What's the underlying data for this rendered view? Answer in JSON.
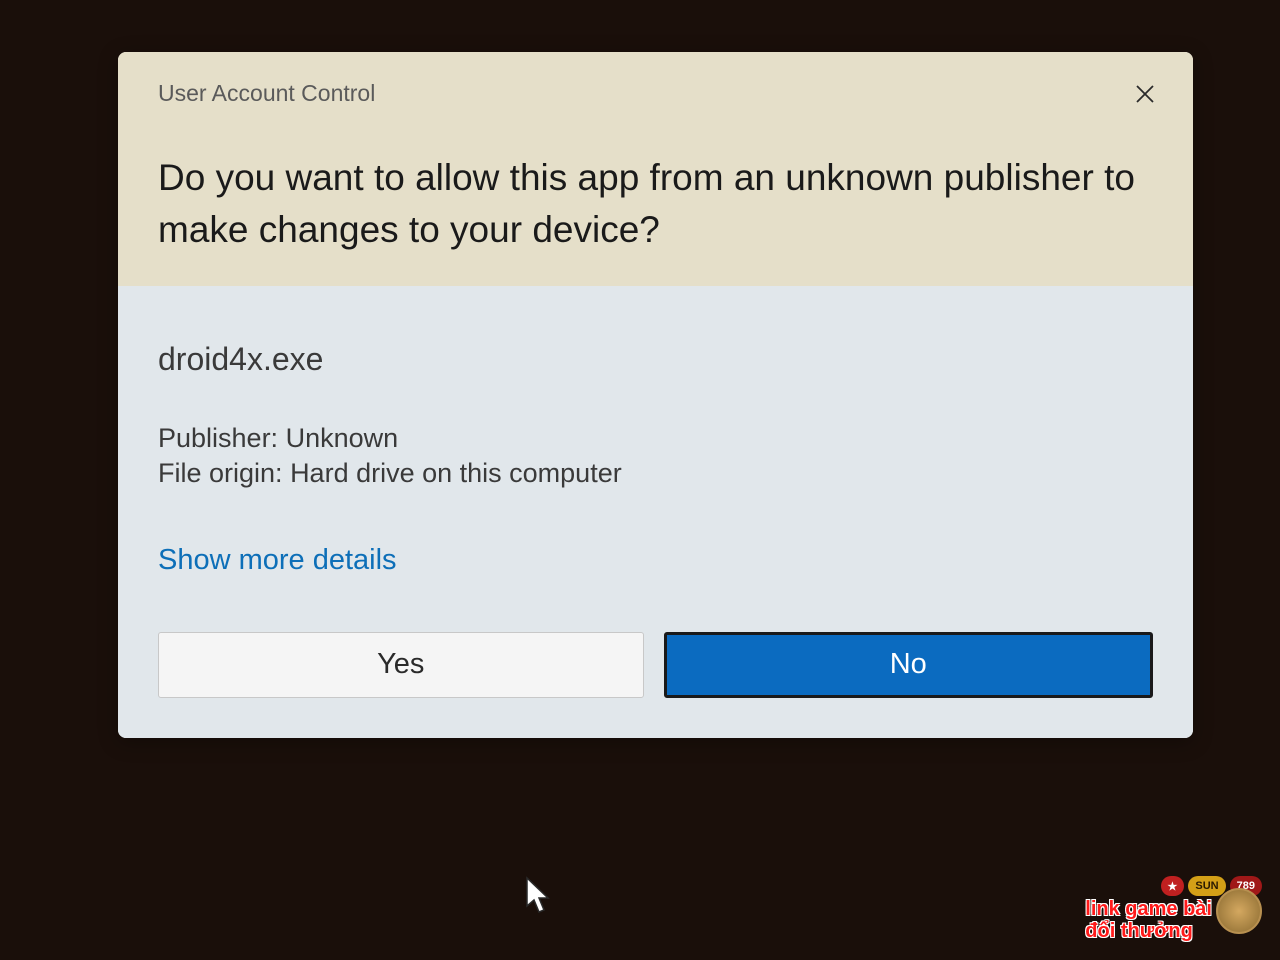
{
  "dialog": {
    "title": "User Account Control",
    "question": "Do you want to allow this app from an unknown publisher to make changes to your device?",
    "app_name": "droid4x.exe",
    "publisher_label": "Publisher:",
    "publisher_value": "Unknown",
    "origin_label": "File origin:",
    "origin_value": "Hard drive on this computer",
    "show_more": "Show more details",
    "yes_label": "Yes",
    "no_label": "No"
  },
  "watermark": {
    "line1": "link game bài",
    "line2": "đổi thưởng",
    "badge_num": "789",
    "badge_sun": "SUN"
  }
}
